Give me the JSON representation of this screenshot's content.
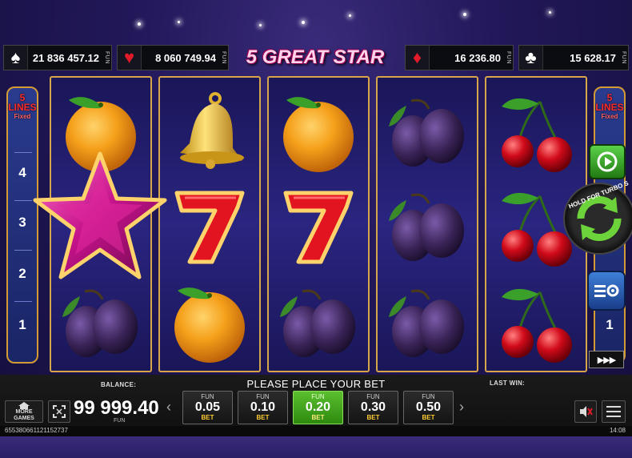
{
  "game": {
    "title": "5 GREAT STAR"
  },
  "jackpots": [
    {
      "suit": "spade-icon",
      "glyph": "♠",
      "amount": "21 836 457.12",
      "currency": "FUN",
      "color": "#ffffff"
    },
    {
      "suit": "heart-icon",
      "glyph": "♥",
      "amount": "8 060 749.94",
      "currency": "FUN",
      "color": "#e21b2b"
    },
    {
      "suit": "diamond-icon",
      "glyph": "♦",
      "amount": "16 236.80",
      "currency": "FUN",
      "color": "#e21b2b"
    },
    {
      "suit": "club-icon",
      "glyph": "♣",
      "amount": "15 628.17",
      "currency": "FUN",
      "color": "#ffffff"
    }
  ],
  "lines_panel": {
    "count": "5",
    "label": "LINES",
    "fixed": "Fixed",
    "numbers": [
      "4",
      "3",
      "2",
      "1"
    ]
  },
  "reels": [
    [
      "orange",
      "star",
      "plum"
    ],
    [
      "bell",
      "seven",
      "orange"
    ],
    [
      "orange",
      "seven",
      "plum"
    ],
    [
      "plum",
      "plum",
      "plum"
    ],
    [
      "cherry",
      "cherry",
      "cherry"
    ]
  ],
  "controls": {
    "turbo_hint": "HOLD FOR TURBO S",
    "autoplay_icon": "autoplay-icon",
    "settings_icon": "settings-icon",
    "fast_forward": "▶▶▶",
    "right_line_number": "1"
  },
  "bottom": {
    "balance_label": "BALANCE:",
    "balance_value": "99 999.40",
    "balance_currency": "FUN",
    "message": "PLEASE PLACE YOUR BET",
    "last_win_label": "LAST WIN:",
    "more_games": "MORE GAMES",
    "bets": [
      {
        "currency": "FUN",
        "value": "0.05",
        "label": "BET",
        "active": false
      },
      {
        "currency": "FUN",
        "value": "0.10",
        "label": "BET",
        "active": false
      },
      {
        "currency": "FUN",
        "value": "0.20",
        "label": "BET",
        "active": true
      },
      {
        "currency": "FUN",
        "value": "0.30",
        "label": "BET",
        "active": false
      },
      {
        "currency": "FUN",
        "value": "0.50",
        "label": "BET",
        "active": false
      }
    ],
    "game_id": "6553806611211527​37",
    "clock": "14:08"
  },
  "colors": {
    "accent_gold": "#d8a64a",
    "active_bet": "#3fa51a",
    "title_pink": "#ff4fa3"
  }
}
